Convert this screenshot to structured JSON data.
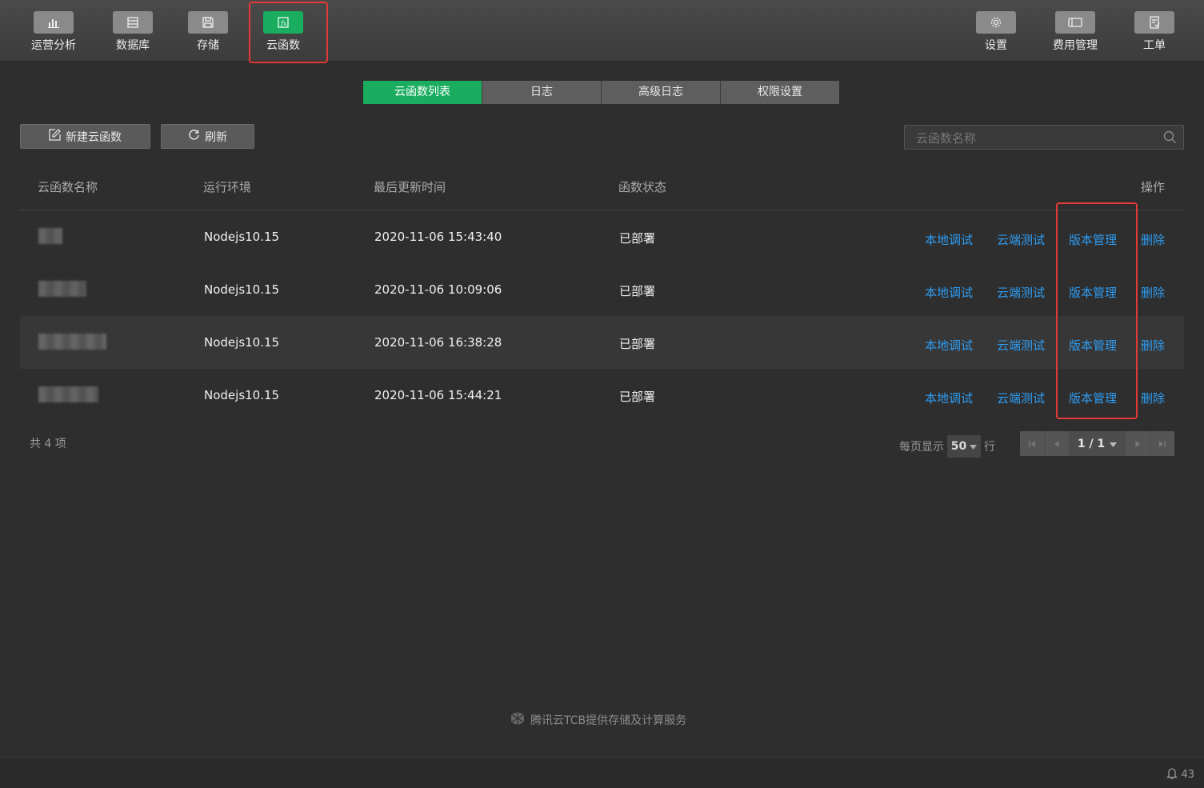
{
  "toolbar": {
    "left": [
      {
        "label": "运营分析",
        "icon": "bar-chart-icon"
      },
      {
        "label": "数据库",
        "icon": "database-icon"
      },
      {
        "label": "存储",
        "icon": "storage-icon"
      },
      {
        "label": "云函数",
        "icon": "function-icon"
      }
    ],
    "right": [
      {
        "label": "设置",
        "icon": "gear-icon"
      },
      {
        "label": "费用管理",
        "icon": "billing-icon"
      },
      {
        "label": "工单",
        "icon": "ticket-icon"
      }
    ],
    "active_color": "#1aad5f"
  },
  "tabs": [
    {
      "label": "云函数列表",
      "active": true
    },
    {
      "label": "日志",
      "active": false
    },
    {
      "label": "高级日志",
      "active": false
    },
    {
      "label": "权限设置",
      "active": false
    }
  ],
  "actions": {
    "new_label": "新建云函数",
    "refresh_label": "刷新"
  },
  "search": {
    "placeholder": "云函数名称",
    "value": ""
  },
  "table": {
    "columns": [
      "云函数名称",
      "运行环境",
      "最后更新时间",
      "函数状态",
      "操作"
    ],
    "rows": [
      {
        "name": "",
        "runtime": "Nodejs10.15",
        "updated": "2020-11-06 15:43:40",
        "status": "已部署"
      },
      {
        "name": "",
        "runtime": "Nodejs10.15",
        "updated": "2020-11-06 10:09:06",
        "status": "已部署"
      },
      {
        "name": "",
        "runtime": "Nodejs10.15",
        "updated": "2020-11-06 16:38:28",
        "status": "已部署"
      },
      {
        "name": "",
        "runtime": "Nodejs10.15",
        "updated": "2020-11-06 15:44:21",
        "status": "已部署"
      }
    ],
    "row_actions": [
      "本地调试",
      "云端测试",
      "版本管理",
      "删除"
    ],
    "link_color": "#2e9cf2"
  },
  "footer": {
    "total": "共 4 项",
    "per_page_label": "每页显示",
    "per_page_value": "50",
    "per_page_suffix": "行",
    "page": "1 / 1"
  },
  "provider": "腾讯云TCB提供存储及计算服务",
  "notifications": "43",
  "highlight_color": "#e53935"
}
